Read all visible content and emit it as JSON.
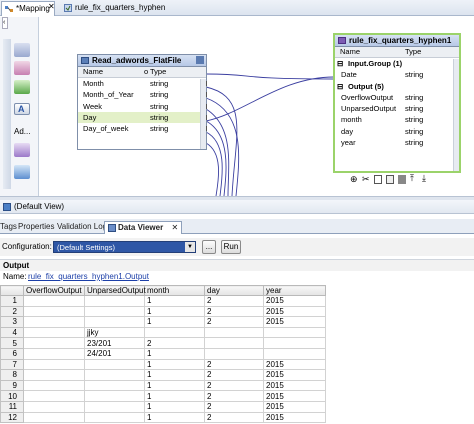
{
  "editor_tabs": [
    {
      "label": "*Mapping",
      "active": true
    },
    {
      "label": "rule_fix_quarters_hyphen",
      "active": false
    }
  ],
  "source": {
    "title": "Read_adwords_FlatFile",
    "col_name": "Name",
    "col_o": "o",
    "col_type": "Type",
    "rows": [
      {
        "name": "Month",
        "type": "string"
      },
      {
        "name": "Month_of_Year",
        "type": "string"
      },
      {
        "name": "Week",
        "type": "string"
      },
      {
        "name": "Day",
        "type": "string"
      },
      {
        "name": "Day_of_week",
        "type": "string"
      }
    ]
  },
  "rule": {
    "title": "rule_fix_quarters_hyphen1",
    "col_name": "Name",
    "col_type": "Type",
    "input_group": "Input.Group (1)",
    "input_rows": [
      {
        "name": "Date",
        "type": "string"
      }
    ],
    "output_group": "Output (5)",
    "output_rows": [
      {
        "name": "OverflowOutput",
        "type": "string"
      },
      {
        "name": "UnparsedOutput",
        "type": "string"
      },
      {
        "name": "month",
        "type": "string"
      },
      {
        "name": "day",
        "type": "string"
      },
      {
        "name": "year",
        "type": "string"
      }
    ]
  },
  "palette_label": "Ad...",
  "view_label": "(Default View)",
  "lower_tabs": [
    "Tags",
    "Properties",
    "Validation Log",
    "Data Viewer"
  ],
  "active_lower_tab": "Data Viewer",
  "config": {
    "label": "Configuration:",
    "value": "(Default Settings)",
    "more_button": "...",
    "run_button": "Run"
  },
  "output": {
    "section_title": "Output",
    "name_label": "Name:",
    "name_value": "rule_fix_quarters_hyphen1.Output"
  },
  "grid": {
    "columns": [
      "",
      "OverflowOutput",
      "UnparsedOutput",
      "month",
      "day",
      "year"
    ],
    "rows": [
      [
        "1",
        "",
        "",
        "1",
        "2",
        "2015"
      ],
      [
        "2",
        "",
        "",
        "1",
        "2",
        "2015"
      ],
      [
        "3",
        "",
        "",
        "1",
        "2",
        "2015"
      ],
      [
        "4",
        "",
        "jjky",
        "",
        "",
        ""
      ],
      [
        "5",
        "",
        "23/201",
        "2",
        "",
        ""
      ],
      [
        "6",
        "",
        "24/201",
        "1",
        "",
        ""
      ],
      [
        "7",
        "",
        "",
        "1",
        "2",
        "2015"
      ],
      [
        "8",
        "",
        "",
        "1",
        "2",
        "2015"
      ],
      [
        "9",
        "",
        "",
        "1",
        "2",
        "2015"
      ],
      [
        "10",
        "",
        "",
        "1",
        "2",
        "2015"
      ],
      [
        "11",
        "",
        "",
        "1",
        "2",
        "2015"
      ],
      [
        "12",
        "",
        "",
        "1",
        "2",
        "2015"
      ]
    ]
  },
  "colors": {
    "accent": "#2f57a6",
    "rule_border": "#9bd36a",
    "link_line": "#3b3fa0",
    "selected_row": "#e3f0c8"
  }
}
